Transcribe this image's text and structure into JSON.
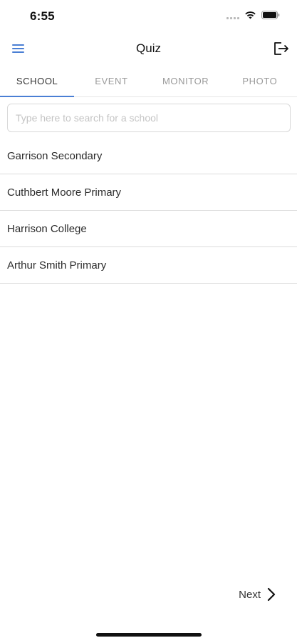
{
  "status_bar": {
    "time": "6:55"
  },
  "nav": {
    "title": "Quiz"
  },
  "tabs": [
    {
      "label": "SCHOOL",
      "active": true
    },
    {
      "label": "EVENT",
      "active": false
    },
    {
      "label": "MONITOR",
      "active": false
    },
    {
      "label": "PHOTO",
      "active": false
    }
  ],
  "search": {
    "placeholder": "Type here to search for a school",
    "value": ""
  },
  "schools": [
    {
      "name": "Garrison Secondary"
    },
    {
      "name": "Cuthbert Moore Primary"
    },
    {
      "name": "Harrison College"
    },
    {
      "name": "Arthur Smith Primary"
    }
  ],
  "footer": {
    "next_label": "Next"
  },
  "colors": {
    "accent": "#4a7fd4",
    "divider": "#dcdcdc",
    "placeholder": "#c4c4c4"
  }
}
